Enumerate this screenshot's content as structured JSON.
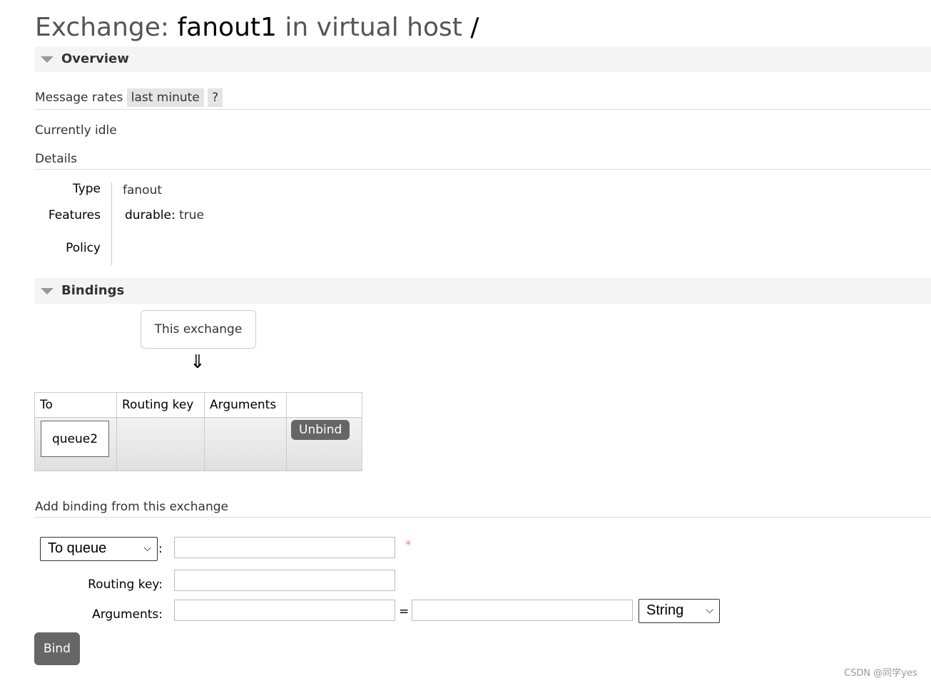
{
  "title": {
    "prefix": "Exchange:",
    "name": "fanout1",
    "mid": "in virtual host",
    "vhost": "/"
  },
  "overview": {
    "heading": "Overview",
    "message_rates_label": "Message rates",
    "rate_period": "last minute",
    "help": "?",
    "status": "Currently idle",
    "details_heading": "Details",
    "details": {
      "type_label": "Type",
      "type_value": "fanout",
      "features_label": "Features",
      "features_key": "durable:",
      "features_value": "true",
      "policy_label": "Policy"
    }
  },
  "bindings": {
    "heading": "Bindings",
    "source": "This exchange",
    "arrow": "⇓",
    "columns": [
      "To",
      "Routing key",
      "Arguments",
      ""
    ],
    "rows": [
      {
        "to": "queue2",
        "routing_key": "",
        "arguments": "",
        "action": "Unbind"
      }
    ]
  },
  "add_binding": {
    "heading": "Add binding from this exchange",
    "destination_type": "To queue",
    "colon": ":",
    "required_mark": "*",
    "routing_key_label": "Routing key:",
    "arguments_label": "Arguments:",
    "equals": "=",
    "arg_type": "String",
    "bind_label": "Bind"
  },
  "watermark": "CSDN @同学yes"
}
